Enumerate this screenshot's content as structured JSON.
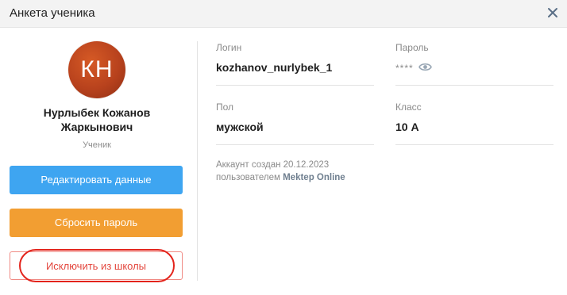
{
  "header": {
    "title": "Анкета ученика"
  },
  "profile": {
    "initials": "КН",
    "name_line1": "Нурлыбек Кожанов",
    "name_line2": "Жаркынович",
    "role": "Ученик"
  },
  "actions": {
    "edit_label": "Редактировать данные",
    "reset_label": "Сбросить пароль",
    "exclude_label": "Исключить из школы"
  },
  "fields": {
    "login_label": "Логин",
    "login_value": "kozhanov_nurlybek_1",
    "password_label": "Пароль",
    "password_value": "****",
    "gender_label": "Пол",
    "gender_value": "мужской",
    "class_label": "Класс",
    "class_value": "10 А"
  },
  "created": {
    "line1": "Аккаунт создан 20.12.2023",
    "line2_prefix": "пользователем ",
    "line2_author": "Mektep Online"
  },
  "colors": {
    "edit_button": "#3ea5f1",
    "reset_button": "#f29e32",
    "exclude_text": "#e3463d",
    "highlight_circle": "#e3241c"
  }
}
